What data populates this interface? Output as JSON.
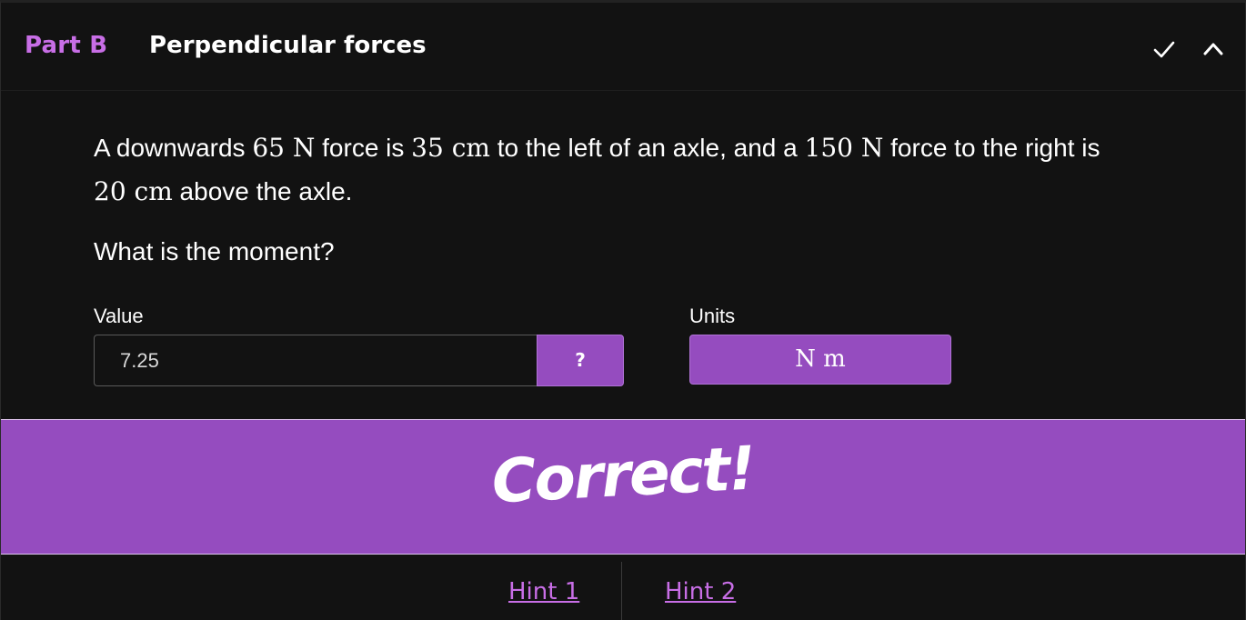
{
  "header": {
    "part_label": "Part B",
    "title": "Perpendicular forces",
    "icons": [
      "check-icon",
      "chevron-up-icon"
    ]
  },
  "question": {
    "t1": "A downwards ",
    "m1": "65 N",
    "t2": " force is ",
    "m2": "35 cm",
    "t3": " to the left of an axle, and a ",
    "m3": "150 N",
    "t4": " force to the right is ",
    "m4": "20 cm",
    "t5": " above the axle.",
    "prompt": "What is the moment?"
  },
  "answer": {
    "value_label": "Value",
    "value": "7.25",
    "help_label": "?",
    "units_label": "Units",
    "units_value": "N m"
  },
  "feedback": {
    "text": "Correct!"
  },
  "hints": {
    "hint1": "Hint 1",
    "hint2": "Hint 2"
  },
  "colors": {
    "background": "#121212",
    "accent": "#954cbf",
    "accent_text": "#c86ee6",
    "text": "#ffffff"
  }
}
